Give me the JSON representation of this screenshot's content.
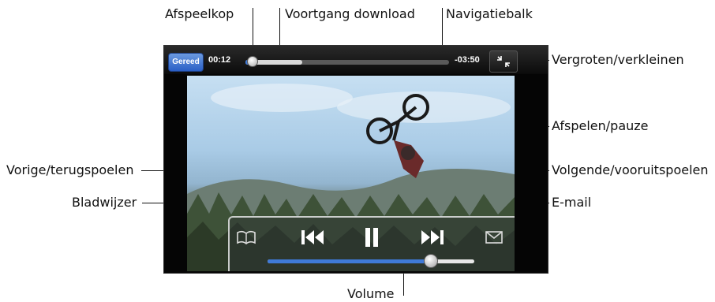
{
  "callouts": {
    "playhead": "Afspeelkop",
    "download_progress": "Voortgang download",
    "scrubber": "Navigatiebalk",
    "zoom": "Vergroten/verkleinen",
    "play_pause": "Afspelen/pauze",
    "previous": "Vorige/terugspoelen",
    "next": "Volgende/vooruitspoelen",
    "bookmark": "Bladwijzer",
    "email": "E-mail",
    "volume": "Volume"
  },
  "player": {
    "done_label": "Gereed",
    "elapsed": "00:12",
    "remaining": "-03:50",
    "playback_progress": 0.02,
    "download_progress": 0.28,
    "volume_level": 0.77
  },
  "icons": {
    "zoom": "zoom-icon",
    "bookmark": "book-icon",
    "previous": "rewind-icon",
    "play_pause": "pause-icon",
    "next": "fast-forward-icon",
    "email": "envelope-icon"
  },
  "colors": {
    "accent": "#3f7ad8",
    "done_button": "#2a5fc6"
  }
}
